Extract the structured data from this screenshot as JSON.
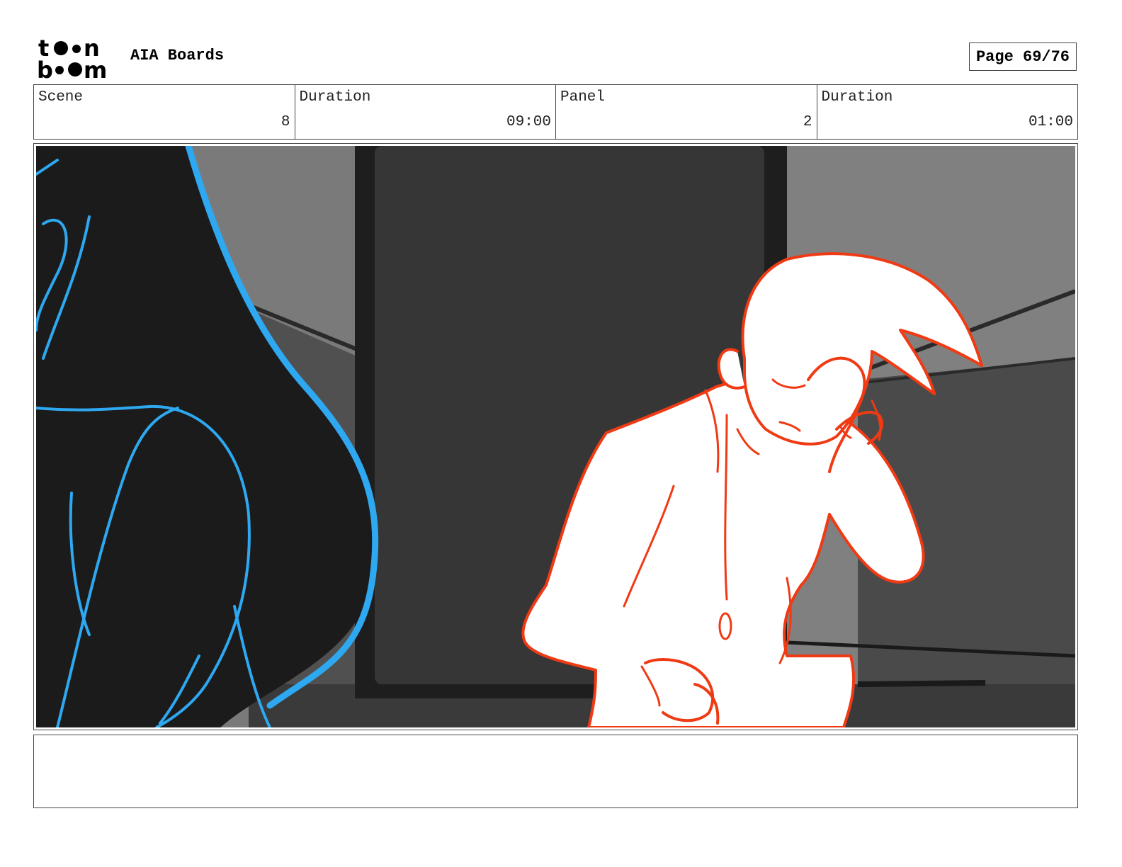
{
  "header": {
    "logo_text": "toonboom",
    "title": "AIA Boards",
    "page_label": "Page 69/76"
  },
  "info": {
    "scene_label": "Scene",
    "scene_value": "8",
    "duration_label": "Duration",
    "duration_value": "09:00",
    "panel_label": "Panel",
    "panel_value": "2",
    "panel_duration_label": "Duration",
    "panel_duration_value": "01:00"
  },
  "notes": {
    "text": ""
  },
  "colors": {
    "sketch_blue": "#2ea8f0",
    "sketch_red": "#f03a14",
    "silhouette": "#1b1b1b",
    "background_gray": "#7a7a7a",
    "dark_door": "#363636"
  }
}
